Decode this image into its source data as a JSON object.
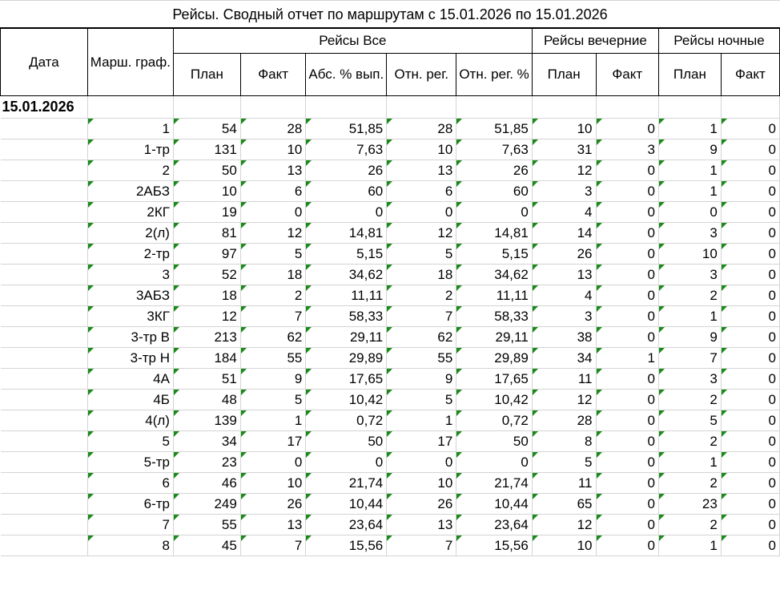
{
  "title": "Рейсы. Сводный отчет по маршрутам с 15.01.2026 по 15.01.2026",
  "headers": {
    "date": "Дата",
    "route": "Марш. граф.",
    "all": "Рейсы Все",
    "evening": "Рейсы вечерние",
    "night": "Рейсы ночные",
    "plan": "План",
    "fact": "Факт",
    "abs_pct": "Абс. % вып.",
    "rel_reg": "Отн. рег.",
    "rel_reg_pct": "Отн. рег. %"
  },
  "date_group": "15.01.2026",
  "rows": [
    [
      "1",
      "54",
      "28",
      "51,85",
      "28",
      "51,85",
      "10",
      "0",
      "1",
      "0"
    ],
    [
      "1-тр",
      "131",
      "10",
      "7,63",
      "10",
      "7,63",
      "31",
      "3",
      "9",
      "0"
    ],
    [
      "2",
      "50",
      "13",
      "26",
      "13",
      "26",
      "12",
      "0",
      "1",
      "0"
    ],
    [
      "2АБЗ",
      "10",
      "6",
      "60",
      "6",
      "60",
      "3",
      "0",
      "1",
      "0"
    ],
    [
      "2КГ",
      "19",
      "0",
      "0",
      "0",
      "0",
      "4",
      "0",
      "0",
      "0"
    ],
    [
      "2(л)",
      "81",
      "12",
      "14,81",
      "12",
      "14,81",
      "14",
      "0",
      "3",
      "0"
    ],
    [
      "2-тр",
      "97",
      "5",
      "5,15",
      "5",
      "5,15",
      "26",
      "0",
      "10",
      "0"
    ],
    [
      "3",
      "52",
      "18",
      "34,62",
      "18",
      "34,62",
      "13",
      "0",
      "3",
      "0"
    ],
    [
      "3АБЗ",
      "18",
      "2",
      "11,11",
      "2",
      "11,11",
      "4",
      "0",
      "2",
      "0"
    ],
    [
      "3КГ",
      "12",
      "7",
      "58,33",
      "7",
      "58,33",
      "3",
      "0",
      "1",
      "0"
    ],
    [
      "3-тр В",
      "213",
      "62",
      "29,11",
      "62",
      "29,11",
      "38",
      "0",
      "9",
      "0"
    ],
    [
      "3-тр Н",
      "184",
      "55",
      "29,89",
      "55",
      "29,89",
      "34",
      "1",
      "7",
      "0"
    ],
    [
      "4А",
      "51",
      "9",
      "17,65",
      "9",
      "17,65",
      "11",
      "0",
      "3",
      "0"
    ],
    [
      "4Б",
      "48",
      "5",
      "10,42",
      "5",
      "10,42",
      "12",
      "0",
      "2",
      "0"
    ],
    [
      "4(л)",
      "139",
      "1",
      "0,72",
      "1",
      "0,72",
      "28",
      "0",
      "5",
      "0"
    ],
    [
      "5",
      "34",
      "17",
      "50",
      "17",
      "50",
      "8",
      "0",
      "2",
      "0"
    ],
    [
      "5-тр",
      "23",
      "0",
      "0",
      "0",
      "0",
      "5",
      "0",
      "1",
      "0"
    ],
    [
      "6",
      "46",
      "10",
      "21,74",
      "10",
      "21,74",
      "11",
      "0",
      "2",
      "0"
    ],
    [
      "6-тр",
      "249",
      "26",
      "10,44",
      "26",
      "10,44",
      "65",
      "0",
      "23",
      "0"
    ],
    [
      "7",
      "55",
      "13",
      "23,64",
      "13",
      "23,64",
      "12",
      "0",
      "2",
      "0"
    ],
    [
      "8",
      "45",
      "7",
      "15,56",
      "7",
      "15,56",
      "10",
      "0",
      "1",
      "0"
    ]
  ],
  "colors": {
    "flag": "#1a8a1a",
    "grid": "#d4d4d4",
    "border": "#000000"
  }
}
